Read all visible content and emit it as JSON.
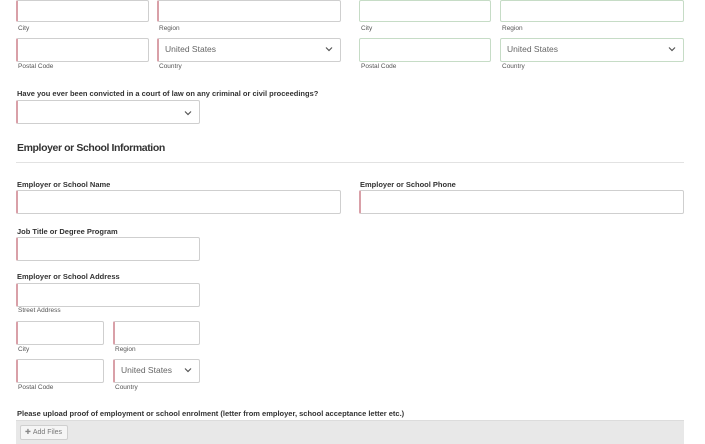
{
  "addr_left": {
    "city_label": "City",
    "region_label": "Region",
    "postal_label": "Postal Code",
    "country_label": "Country",
    "country_value": "United States"
  },
  "addr_right": {
    "city_label": "City",
    "region_label": "Region",
    "postal_label": "Postal Code",
    "country_label": "Country",
    "country_value": "United States"
  },
  "conviction": {
    "question": "Have you ever been convicted in a court of law on any criminal or civil proceedings?",
    "value": ""
  },
  "employer_section": {
    "title": "Employer or School Information",
    "name_label": "Employer or School Name",
    "phone_label": "Employer or School Phone",
    "job_label": "Job Title or Degree Program",
    "address_label": "Employer or School Address",
    "street_label": "Street Address",
    "city_label": "City",
    "region_label": "Region",
    "postal_label": "Postal Code",
    "country_label": "Country",
    "country_value": "United States"
  },
  "upload": {
    "prompt": "Please upload proof of employment or school enrolment (letter from employer, school acceptance letter etc.)",
    "add_files_label": "Add Files"
  },
  "icons": {
    "dropdown": "chevron-down-icon",
    "add": "plus-icon"
  },
  "colors": {
    "required_border": "#d9a0a8",
    "valid_border": "#c6dcc6",
    "upload_bg": "#e8e8e8"
  }
}
